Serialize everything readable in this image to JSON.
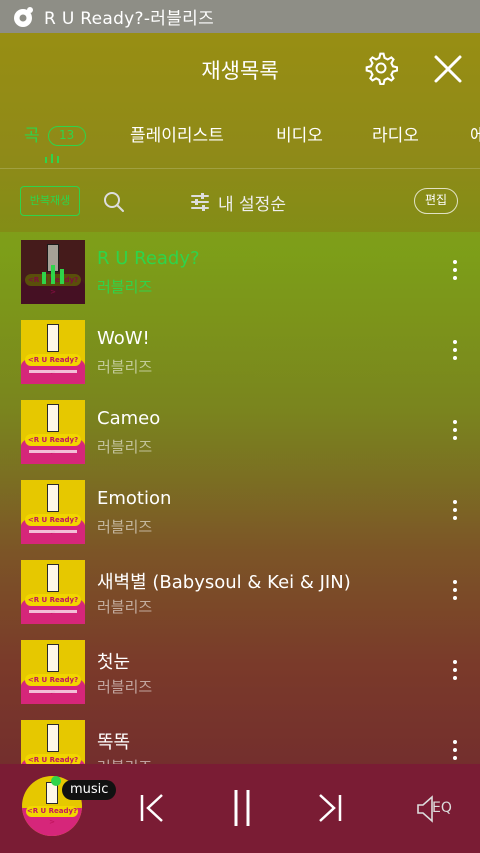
{
  "status": {
    "title": "R U Ready?-러블리즈"
  },
  "header": {
    "title": "재생목록"
  },
  "tabs": [
    {
      "label": "곡",
      "badge": "13"
    },
    {
      "label": "플레이리스트"
    },
    {
      "label": "비디오"
    },
    {
      "label": "라디오"
    },
    {
      "label": "에"
    }
  ],
  "toolbar": {
    "repeat_label": "반복재생",
    "sort_label": "내 설정순",
    "edit_label": "편집"
  },
  "album_art_text": "<R U Ready?>",
  "songs": [
    {
      "title": "R U Ready?",
      "artist": "러블리즈",
      "playing": true
    },
    {
      "title": "WoW!",
      "artist": "러블리즈"
    },
    {
      "title": "Cameo",
      "artist": "러블리즈"
    },
    {
      "title": "Emotion",
      "artist": "러블리즈"
    },
    {
      "title": "새벽별 (Babysoul & Kei & JIN)",
      "artist": "러블리즈"
    },
    {
      "title": "첫눈",
      "artist": "러블리즈"
    },
    {
      "title": "똑똑",
      "artist": "러블리즈"
    }
  ],
  "player": {
    "badge": "music",
    "eq_label": "EQ"
  },
  "colors": {
    "accent": "#2fd44a",
    "player_bg": "#7a1c34",
    "statusbar": "#8e8e86"
  }
}
